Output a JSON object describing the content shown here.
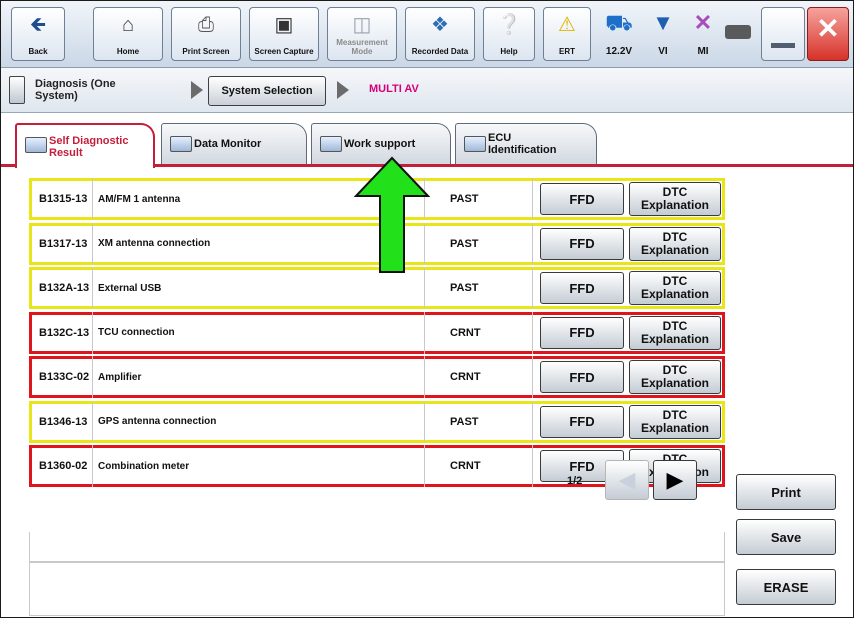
{
  "toolbar": {
    "back": "Back",
    "home": "Home",
    "print_screen": "Print Screen",
    "screen_capture": "Screen Capture",
    "measurement_mode": "Measurement Mode",
    "recorded_data": "Recorded Data",
    "help": "Help",
    "ert": "ERT",
    "voltage": "12.2V",
    "vi": "VI",
    "mi": "MI"
  },
  "breadcrumb": {
    "item1": "Diagnosis (One System)",
    "item2": "System Selection",
    "item3": "MULTI AV"
  },
  "tabs": [
    {
      "label": "Self Diagnostic Result"
    },
    {
      "label": "Data Monitor"
    },
    {
      "label": "Work support"
    },
    {
      "label": "ECU Identification"
    }
  ],
  "dtcs": [
    {
      "code": "B1315-13",
      "description": "AM/FM 1 antenna",
      "status": "PAST",
      "ffd": "FFD",
      "explain1": "DTC",
      "explain2": "Explanation"
    },
    {
      "code": "B1317-13",
      "description": "XM antenna connection",
      "status": "PAST",
      "ffd": "FFD",
      "explain1": "DTC",
      "explain2": "Explanation"
    },
    {
      "code": "B132A-13",
      "description": "External USB",
      "status": "PAST",
      "ffd": "FFD",
      "explain1": "DTC",
      "explain2": "Explanation"
    },
    {
      "code": "B132C-13",
      "description": "TCU connection",
      "status": "CRNT",
      "ffd": "FFD",
      "explain1": "DTC",
      "explain2": "Explanation"
    },
    {
      "code": "B133C-02",
      "description": "Amplifier",
      "status": "CRNT",
      "ffd": "FFD",
      "explain1": "DTC",
      "explain2": "Explanation"
    },
    {
      "code": "B1346-13",
      "description": "GPS antenna connection",
      "status": "PAST",
      "ffd": "FFD",
      "explain1": "DTC",
      "explain2": "Explanation"
    },
    {
      "code": "B1360-02",
      "description": "Combination meter",
      "status": "CRNT",
      "ffd": "FFD",
      "explain1": "DTC",
      "explain2": "Explanation"
    }
  ],
  "pager": {
    "label": "1/2"
  },
  "side_buttons": {
    "print": "Print",
    "save": "Save",
    "erase": "ERASE"
  },
  "colors": {
    "past_border": "#e8e617",
    "current_border": "#e0141b",
    "active_tab": "#c41e3a",
    "annotation_arrow": "#22e01a"
  }
}
